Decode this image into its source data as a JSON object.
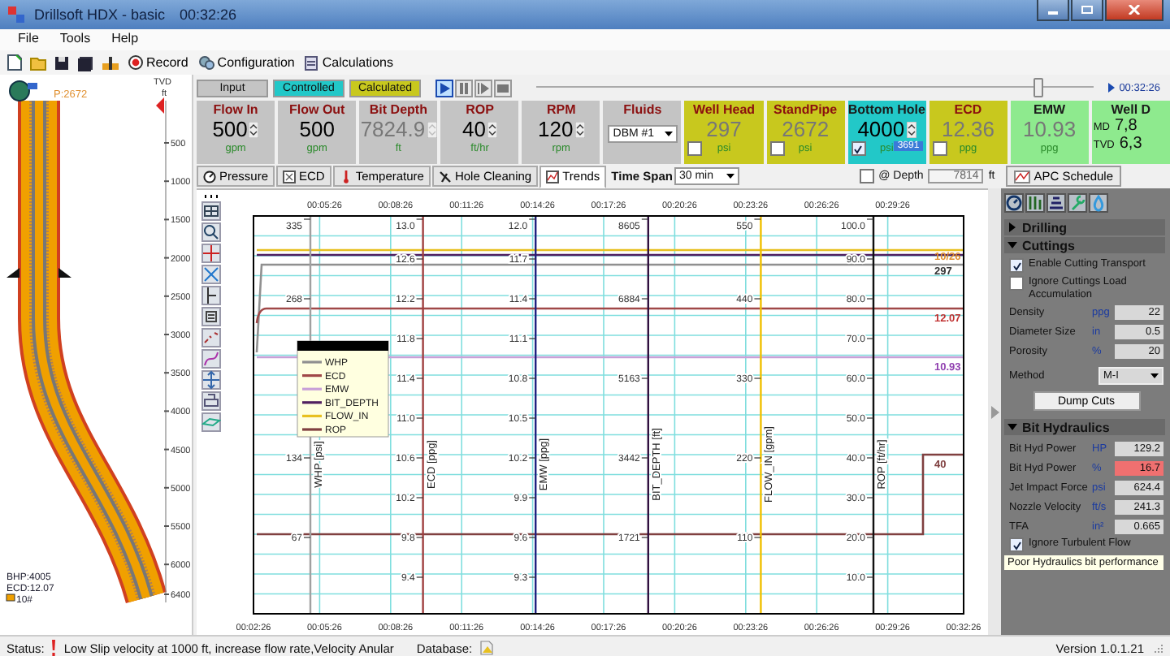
{
  "window": {
    "title": "Drillsoft HDX - basic",
    "clock": "00:32:26"
  },
  "menu": [
    "File",
    "Tools",
    "Help"
  ],
  "toolbar": {
    "buttons": [
      "Record",
      "Configuration",
      "Calculations"
    ]
  },
  "well": {
    "pressure": "P:2672",
    "axis_title": "TVD",
    "axis_unit": "ft",
    "depth_ticks": [
      "500",
      "1000",
      "1500",
      "2000",
      "2500",
      "3000",
      "3500",
      "4000",
      "4500",
      "5000",
      "5500",
      "6000",
      "6400"
    ],
    "bhp": "BHP:4005",
    "ecd": "ECD:12.07",
    "legend": "10#"
  },
  "legend_row": [
    {
      "label": "Input",
      "color": "#c4c4c4"
    },
    {
      "label": "Controlled",
      "color": "#22c8c8"
    },
    {
      "label": "Calculated",
      "color": "#c8c81e"
    }
  ],
  "playback": [
    {
      "kind": "play",
      "selected": true
    },
    {
      "kind": "pause",
      "selected": false
    },
    {
      "kind": "step",
      "selected": false
    },
    {
      "kind": "stop",
      "selected": false
    }
  ],
  "timeline": {
    "level": 0.9,
    "time": "00:32:26"
  },
  "tiles": [
    {
      "label": "Flow In",
      "value": "500",
      "unit": "gpm",
      "color": "#c4c4c4",
      "kind": "spin",
      "disabled": false
    },
    {
      "label": "Flow Out",
      "value": "500",
      "unit": "gpm",
      "color": "#c4c4c4",
      "kind": "value",
      "disabled": false
    },
    {
      "label": "Bit Depth",
      "value": "7824.9",
      "unit": "ft",
      "color": "#c4c4c4",
      "kind": "spin",
      "disabled": true
    },
    {
      "label": "ROP",
      "value": "40",
      "unit": "ft/hr",
      "color": "#c4c4c4",
      "kind": "spin",
      "disabled": false
    },
    {
      "label": "RPM",
      "value": "120",
      "unit": "rpm",
      "color": "#c4c4c4",
      "kind": "spin",
      "disabled": false
    },
    {
      "label": "Fluids",
      "value": "DBM #1",
      "color": "#c4c4c4",
      "kind": "select"
    },
    {
      "label": "Well Head",
      "value": "297",
      "unit": "psi",
      "color": "#c8c81e",
      "kind": "value",
      "disabled": true,
      "checked": false
    },
    {
      "label": "StandPipe",
      "value": "2672",
      "unit": "psi",
      "color": "#c8c81e",
      "kind": "value",
      "disabled": true,
      "checked": false
    },
    {
      "label": "Bottom Hole",
      "value": "4000",
      "unit": "psi",
      "color": "#22c8c8",
      "kind": "spin",
      "disabled": false,
      "checked": true,
      "setpoint": "3691"
    },
    {
      "label": "ECD",
      "value": "12.36",
      "unit": "ppg",
      "color": "#c8c81e",
      "kind": "value",
      "disabled": true,
      "checked": false
    },
    {
      "label": "EMW",
      "value": "10.93",
      "unit": "ppg",
      "color": "#8eea8e",
      "kind": "value",
      "disabled": true
    },
    {
      "label": "Well D",
      "color": "#8eea8e",
      "kind": "pair",
      "rows": [
        {
          "name": "MD",
          "value": "7,8"
        },
        {
          "name": "TVD",
          "value": "6,3"
        }
      ]
    }
  ],
  "tabs": [
    {
      "label": "Pressure",
      "selected": false
    },
    {
      "label": "ECD",
      "selected": false
    },
    {
      "label": "Temperature",
      "selected": false
    },
    {
      "label": "Hole Cleaning",
      "selected": false
    },
    {
      "label": "Trends",
      "selected": true
    }
  ],
  "time_span": {
    "label": "Time Span",
    "value": "30 min"
  },
  "depth_filter": {
    "label": "@ Depth",
    "checked": false,
    "value": "7814",
    "unit": "ft"
  },
  "apc_button": "APC Schedule",
  "trends": {
    "time_labels_top": [
      "00:05:26",
      "00:08:26",
      "00:11:26",
      "00:14:26",
      "00:17:26",
      "00:20:26",
      "00:23:26",
      "00:26:26",
      "00:29:26"
    ],
    "time_labels_bottom": [
      "00:02:26",
      "00:05:26",
      "00:08:26",
      "00:11:26",
      "00:14:26",
      "00:17:26",
      "00:20:26",
      "00:23:26",
      "00:26:26",
      "00:29:26",
      "00:32:26"
    ],
    "axes": [
      {
        "title": "WHP [psi]",
        "color": "#a0a0a0",
        "ticks": [
          "335",
          "268",
          "134",
          "67"
        ]
      },
      {
        "title": "ECD [ppg]",
        "color": "#a04040",
        "ticks": [
          "13.0",
          "12.6",
          "12.2",
          "11.8",
          "11.4",
          "11.0",
          "10.6",
          "10.2",
          "9.8",
          "9.4"
        ]
      },
      {
        "title": "EMW [ppg]",
        "color": "#202080",
        "ticks": [
          "12.0",
          "11.7",
          "11.4",
          "11.1",
          "10.8",
          "10.5",
          "10.2",
          "9.9",
          "9.6",
          "9.3"
        ]
      },
      {
        "title": "BIT_DEPTH [ft]",
        "color": "#301040",
        "ticks": [
          "8605",
          "6884",
          "5163",
          "3442",
          "1721"
        ]
      },
      {
        "title": "FLOW_IN [gpm]",
        "color": "#f0c000",
        "ticks": [
          "550",
          "440",
          "330",
          "220",
          "110"
        ]
      },
      {
        "title": "ROP [ft/hr]",
        "color": "#101010",
        "ticks": [
          "100.0",
          "90.0",
          "80.0",
          "70.0",
          "60.0",
          "50.0",
          "40.0",
          "30.0",
          "20.0",
          "10.0"
        ]
      }
    ],
    "legend": [
      {
        "name": "WHP",
        "color": "#909090"
      },
      {
        "name": "ECD",
        "color": "#a04848"
      },
      {
        "name": "EMW",
        "color": "#c8a0d8"
      },
      {
        "name": "BIT_DEPTH",
        "color": "#502060"
      },
      {
        "name": "FLOW_IN",
        "color": "#e8c020"
      },
      {
        "name": "ROP",
        "color": "#804040"
      }
    ],
    "end_labels": [
      {
        "text": "10/26",
        "color": "#e09030"
      },
      {
        "text": "297",
        "color": "#333333"
      },
      {
        "text": "12.07",
        "color": "#c03030"
      },
      {
        "text": "10.93",
        "color": "#9040b0"
      },
      {
        "text": "40",
        "color": "#804040"
      }
    ]
  },
  "side_panel": {
    "sections": [
      {
        "title": "Drilling",
        "expanded": false
      },
      {
        "title": "Cuttings",
        "expanded": true,
        "items": [
          {
            "kind": "check",
            "label": "Enable Cutting Transport",
            "checked": true
          },
          {
            "kind": "check",
            "label": "Ignore Cuttings Load Accumulation",
            "checked": false
          },
          {
            "kind": "field",
            "label": "Density",
            "unit": "ppg",
            "value": "22",
            "alert": false
          },
          {
            "kind": "field",
            "label": "Diameter Size",
            "unit": "in",
            "value": "0.5",
            "alert": false
          },
          {
            "kind": "field",
            "label": "Porosity",
            "unit": "%",
            "value": "20",
            "alert": false
          },
          {
            "kind": "select",
            "label": "Method",
            "value": "M-I"
          },
          {
            "kind": "button",
            "label": "Dump Cuts"
          }
        ]
      },
      {
        "title": "Bit Hydraulics",
        "expanded": true,
        "items": [
          {
            "kind": "field",
            "label": "Bit Hyd Power",
            "unit": "HP",
            "value": "129.2",
            "alert": false
          },
          {
            "kind": "field",
            "label": "Bit Hyd Power",
            "unit": "%",
            "value": "16.7",
            "alert": true
          },
          {
            "kind": "field",
            "label": "Jet Impact Force",
            "unit": "psi",
            "value": "624.4",
            "alert": false
          },
          {
            "kind": "field",
            "label": "Nozzle Velocity",
            "unit": "ft/s",
            "value": "241.3",
            "alert": false
          },
          {
            "kind": "field",
            "label": "TFA",
            "unit": "in²",
            "value": "0.665",
            "alert": false
          },
          {
            "kind": "check",
            "label": "Ignore Turbulent Flow",
            "checked": true
          },
          {
            "kind": "note",
            "label": "Poor Hydraulics bit performance"
          }
        ]
      }
    ]
  },
  "status_bar": {
    "label": "Status:",
    "message": "Low Slip velocity at 1000 ft, increase flow rate,Velocity Anular",
    "db_label": "Database:",
    "version": "Version 1.0.1.21"
  }
}
